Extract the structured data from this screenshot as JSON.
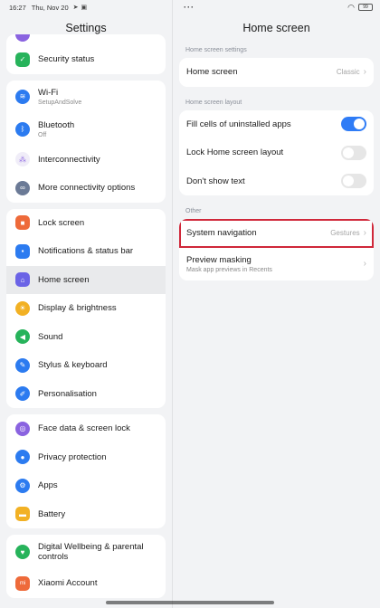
{
  "status": {
    "time": "16:27",
    "date": "Thu, Nov 20",
    "battery": "99"
  },
  "left": {
    "title": "Settings",
    "card1": [
      {
        "label": "Security status",
        "icon": "shield-icon",
        "color": "#27b35b"
      }
    ],
    "card2": [
      {
        "label": "Wi-Fi",
        "sub": "SetupAndSolve",
        "icon": "wifi-icon",
        "color": "#2c7bf0"
      },
      {
        "label": "Bluetooth",
        "sub": "Off",
        "icon": "bluetooth-icon",
        "color": "#2c7bf0"
      },
      {
        "label": "Interconnectivity",
        "icon": "interconnectivity-icon",
        "color": "#8a63e0"
      },
      {
        "label": "More connectivity options",
        "icon": "connectivity-icon",
        "color": "#6b7a96"
      }
    ],
    "card3": [
      {
        "label": "Lock screen",
        "icon": "lock-icon",
        "color": "#ee6a3a"
      },
      {
        "label": "Notifications & status bar",
        "icon": "notification-icon",
        "color": "#2c7bf0"
      },
      {
        "label": "Home screen",
        "icon": "home-icon",
        "color": "#6b63e6"
      },
      {
        "label": "Display & brightness",
        "icon": "sun-icon",
        "color": "#f2b124"
      },
      {
        "label": "Sound",
        "icon": "sound-icon",
        "color": "#27b35b"
      },
      {
        "label": "Stylus & keyboard",
        "icon": "stylus-icon",
        "color": "#2c7bf0"
      },
      {
        "label": "Personalisation",
        "icon": "brush-icon",
        "color": "#2c7bf0"
      }
    ],
    "card4": [
      {
        "label": "Face data & screen lock",
        "icon": "fingerprint-icon",
        "color": "#8a63e0"
      },
      {
        "label": "Privacy protection",
        "icon": "privacy-icon",
        "color": "#2c7bf0"
      },
      {
        "label": "Apps",
        "icon": "gear-icon",
        "color": "#2c7bf0"
      },
      {
        "label": "Battery",
        "icon": "battery-icon",
        "color": "#f2b124"
      }
    ],
    "card5": [
      {
        "label": "Digital Wellbeing & parental controls",
        "icon": "wellbeing-icon",
        "color": "#27b35b"
      },
      {
        "label": "Xiaomi Account",
        "icon": "mi-icon",
        "color": "#ee6a3a"
      }
    ]
  },
  "right": {
    "title": "Home screen",
    "section1": "Home screen settings",
    "home_screen_label": "Home screen",
    "home_screen_value": "Classic",
    "section2": "Home screen layout",
    "fill_cells_label": "Fill cells of uninstalled apps",
    "fill_cells_on": true,
    "lock_layout_label": "Lock Home screen layout",
    "lock_layout_on": false,
    "dont_show_text_label": "Don't show text",
    "dont_show_text_on": false,
    "section3": "Other",
    "system_nav_label": "System navigation",
    "system_nav_value": "Gestures",
    "preview_masking_label": "Preview masking",
    "preview_masking_sub": "Mask app previews in Recents",
    "highlight_color": "#d0283a",
    "toggle_on_color": "#2f7cf6"
  }
}
